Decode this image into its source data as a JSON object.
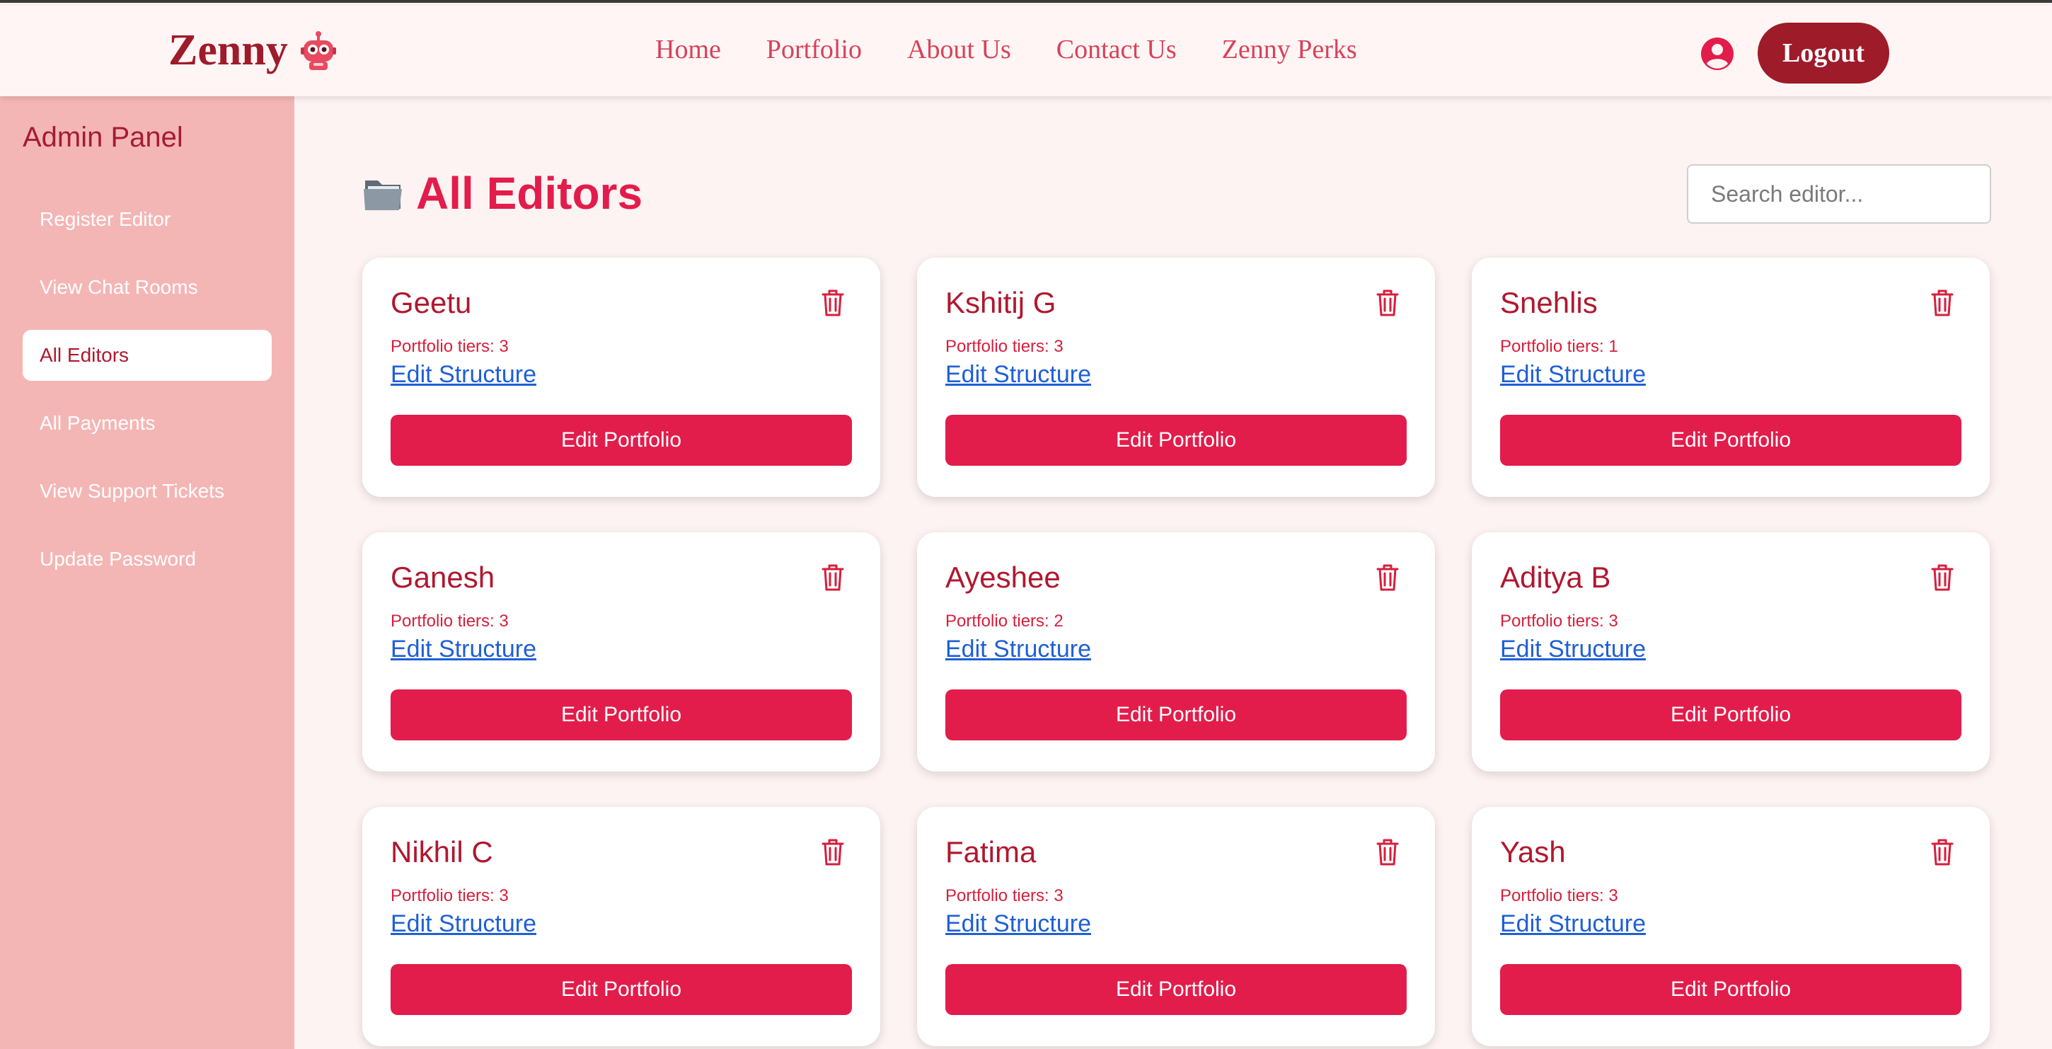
{
  "header": {
    "logo_text": "Zenny",
    "logo_icon": "robot-mascot-icon",
    "nav": [
      "Home",
      "Portfolio",
      "About Us",
      "Contact Us",
      "Zenny Perks"
    ],
    "user_icon": "user-circle-icon",
    "logout_label": "Logout"
  },
  "sidebar": {
    "title": "Admin Panel",
    "items": [
      {
        "label": "Register Editor",
        "active": false
      },
      {
        "label": "View Chat Rooms",
        "active": false
      },
      {
        "label": "All Editors",
        "active": true
      },
      {
        "label": "All Payments",
        "active": false
      },
      {
        "label": "View Support Tickets",
        "active": false
      },
      {
        "label": "Update Password",
        "active": false
      }
    ]
  },
  "main": {
    "title_icon": "folder-icon",
    "title": "All Editors",
    "search_placeholder": "Search editor...",
    "cards": [
      {
        "name": "Geetu",
        "tiers": "Portfolio tiers: 3",
        "link": "Edit Structure",
        "button": "Edit Portfolio"
      },
      {
        "name": "Kshitij G",
        "tiers": "Portfolio tiers: 3",
        "link": "Edit Structure",
        "button": "Edit Portfolio"
      },
      {
        "name": "Snehlis",
        "tiers": "Portfolio tiers: 1",
        "link": "Edit Structure",
        "button": "Edit Portfolio"
      },
      {
        "name": "Ganesh",
        "tiers": "Portfolio tiers: 3",
        "link": "Edit Structure",
        "button": "Edit Portfolio"
      },
      {
        "name": "Ayeshee",
        "tiers": "Portfolio tiers: 2",
        "link": "Edit Structure",
        "button": "Edit Portfolio"
      },
      {
        "name": "Aditya B",
        "tiers": "Portfolio tiers: 3",
        "link": "Edit Structure",
        "button": "Edit Portfolio"
      },
      {
        "name": "Nikhil C",
        "tiers": "Portfolio tiers: 3",
        "link": "Edit Structure",
        "button": "Edit Portfolio"
      },
      {
        "name": "Fatima",
        "tiers": "Portfolio tiers: 3",
        "link": "Edit Structure",
        "button": "Edit Portfolio"
      },
      {
        "name": "Yash",
        "tiers": "Portfolio tiers: 3",
        "link": "Edit Structure",
        "button": "Edit Portfolio"
      }
    ]
  },
  "colors": {
    "brand_dark": "#9e1b2a",
    "accent": "#e21d4b",
    "sidebar_bg": "#f4b6b5",
    "page_bg": "#fdf3f2",
    "link": "#1f5fd6"
  }
}
